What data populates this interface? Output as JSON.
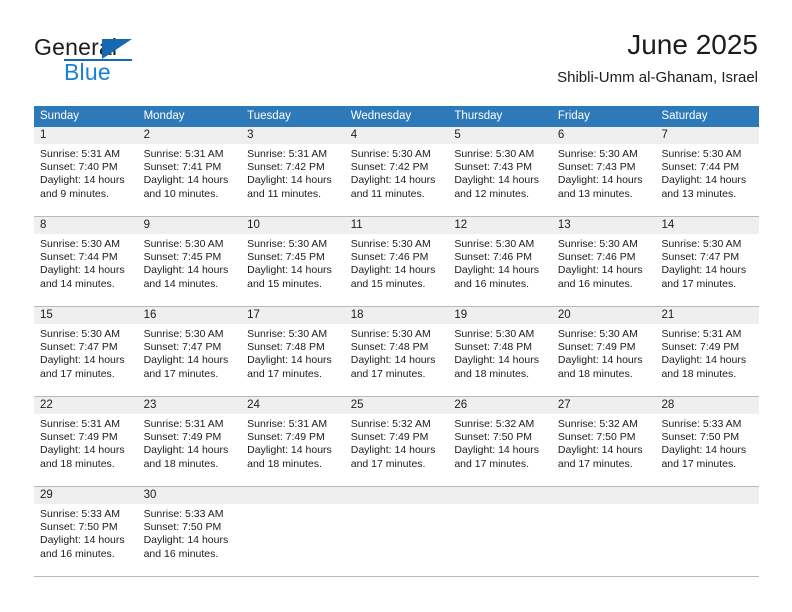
{
  "brand": {
    "name_primary": "General",
    "name_secondary": "Blue"
  },
  "header": {
    "title": "June 2025",
    "subtitle": "Shibli-Umm al-Ghanam, Israel"
  },
  "calendar": {
    "weekday_headers": [
      "Sunday",
      "Monday",
      "Tuesday",
      "Wednesday",
      "Thursday",
      "Friday",
      "Saturday"
    ],
    "header_bg": "#2e79b9",
    "daynum_bg": "#efefef",
    "weeks": [
      [
        {
          "day": "1",
          "sunrise": "Sunrise: 5:31 AM",
          "sunset": "Sunset: 7:40 PM",
          "daylight": "Daylight: 14 hours and 9 minutes."
        },
        {
          "day": "2",
          "sunrise": "Sunrise: 5:31 AM",
          "sunset": "Sunset: 7:41 PM",
          "daylight": "Daylight: 14 hours and 10 minutes."
        },
        {
          "day": "3",
          "sunrise": "Sunrise: 5:31 AM",
          "sunset": "Sunset: 7:42 PM",
          "daylight": "Daylight: 14 hours and 11 minutes."
        },
        {
          "day": "4",
          "sunrise": "Sunrise: 5:30 AM",
          "sunset": "Sunset: 7:42 PM",
          "daylight": "Daylight: 14 hours and 11 minutes."
        },
        {
          "day": "5",
          "sunrise": "Sunrise: 5:30 AM",
          "sunset": "Sunset: 7:43 PM",
          "daylight": "Daylight: 14 hours and 12 minutes."
        },
        {
          "day": "6",
          "sunrise": "Sunrise: 5:30 AM",
          "sunset": "Sunset: 7:43 PM",
          "daylight": "Daylight: 14 hours and 13 minutes."
        },
        {
          "day": "7",
          "sunrise": "Sunrise: 5:30 AM",
          "sunset": "Sunset: 7:44 PM",
          "daylight": "Daylight: 14 hours and 13 minutes."
        }
      ],
      [
        {
          "day": "8",
          "sunrise": "Sunrise: 5:30 AM",
          "sunset": "Sunset: 7:44 PM",
          "daylight": "Daylight: 14 hours and 14 minutes."
        },
        {
          "day": "9",
          "sunrise": "Sunrise: 5:30 AM",
          "sunset": "Sunset: 7:45 PM",
          "daylight": "Daylight: 14 hours and 14 minutes."
        },
        {
          "day": "10",
          "sunrise": "Sunrise: 5:30 AM",
          "sunset": "Sunset: 7:45 PM",
          "daylight": "Daylight: 14 hours and 15 minutes."
        },
        {
          "day": "11",
          "sunrise": "Sunrise: 5:30 AM",
          "sunset": "Sunset: 7:46 PM",
          "daylight": "Daylight: 14 hours and 15 minutes."
        },
        {
          "day": "12",
          "sunrise": "Sunrise: 5:30 AM",
          "sunset": "Sunset: 7:46 PM",
          "daylight": "Daylight: 14 hours and 16 minutes."
        },
        {
          "day": "13",
          "sunrise": "Sunrise: 5:30 AM",
          "sunset": "Sunset: 7:46 PM",
          "daylight": "Daylight: 14 hours and 16 minutes."
        },
        {
          "day": "14",
          "sunrise": "Sunrise: 5:30 AM",
          "sunset": "Sunset: 7:47 PM",
          "daylight": "Daylight: 14 hours and 17 minutes."
        }
      ],
      [
        {
          "day": "15",
          "sunrise": "Sunrise: 5:30 AM",
          "sunset": "Sunset: 7:47 PM",
          "daylight": "Daylight: 14 hours and 17 minutes."
        },
        {
          "day": "16",
          "sunrise": "Sunrise: 5:30 AM",
          "sunset": "Sunset: 7:47 PM",
          "daylight": "Daylight: 14 hours and 17 minutes."
        },
        {
          "day": "17",
          "sunrise": "Sunrise: 5:30 AM",
          "sunset": "Sunset: 7:48 PM",
          "daylight": "Daylight: 14 hours and 17 minutes."
        },
        {
          "day": "18",
          "sunrise": "Sunrise: 5:30 AM",
          "sunset": "Sunset: 7:48 PM",
          "daylight": "Daylight: 14 hours and 17 minutes."
        },
        {
          "day": "19",
          "sunrise": "Sunrise: 5:30 AM",
          "sunset": "Sunset: 7:48 PM",
          "daylight": "Daylight: 14 hours and 18 minutes."
        },
        {
          "day": "20",
          "sunrise": "Sunrise: 5:30 AM",
          "sunset": "Sunset: 7:49 PM",
          "daylight": "Daylight: 14 hours and 18 minutes."
        },
        {
          "day": "21",
          "sunrise": "Sunrise: 5:31 AM",
          "sunset": "Sunset: 7:49 PM",
          "daylight": "Daylight: 14 hours and 18 minutes."
        }
      ],
      [
        {
          "day": "22",
          "sunrise": "Sunrise: 5:31 AM",
          "sunset": "Sunset: 7:49 PM",
          "daylight": "Daylight: 14 hours and 18 minutes."
        },
        {
          "day": "23",
          "sunrise": "Sunrise: 5:31 AM",
          "sunset": "Sunset: 7:49 PM",
          "daylight": "Daylight: 14 hours and 18 minutes."
        },
        {
          "day": "24",
          "sunrise": "Sunrise: 5:31 AM",
          "sunset": "Sunset: 7:49 PM",
          "daylight": "Daylight: 14 hours and 18 minutes."
        },
        {
          "day": "25",
          "sunrise": "Sunrise: 5:32 AM",
          "sunset": "Sunset: 7:49 PM",
          "daylight": "Daylight: 14 hours and 17 minutes."
        },
        {
          "day": "26",
          "sunrise": "Sunrise: 5:32 AM",
          "sunset": "Sunset: 7:50 PM",
          "daylight": "Daylight: 14 hours and 17 minutes."
        },
        {
          "day": "27",
          "sunrise": "Sunrise: 5:32 AM",
          "sunset": "Sunset: 7:50 PM",
          "daylight": "Daylight: 14 hours and 17 minutes."
        },
        {
          "day": "28",
          "sunrise": "Sunrise: 5:33 AM",
          "sunset": "Sunset: 7:50 PM",
          "daylight": "Daylight: 14 hours and 17 minutes."
        }
      ],
      [
        {
          "day": "29",
          "sunrise": "Sunrise: 5:33 AM",
          "sunset": "Sunset: 7:50 PM",
          "daylight": "Daylight: 14 hours and 16 minutes."
        },
        {
          "day": "30",
          "sunrise": "Sunrise: 5:33 AM",
          "sunset": "Sunset: 7:50 PM",
          "daylight": "Daylight: 14 hours and 16 minutes."
        },
        {
          "day": "",
          "sunrise": "",
          "sunset": "",
          "daylight": ""
        },
        {
          "day": "",
          "sunrise": "",
          "sunset": "",
          "daylight": ""
        },
        {
          "day": "",
          "sunrise": "",
          "sunset": "",
          "daylight": ""
        },
        {
          "day": "",
          "sunrise": "",
          "sunset": "",
          "daylight": ""
        },
        {
          "day": "",
          "sunrise": "",
          "sunset": "",
          "daylight": ""
        }
      ]
    ]
  }
}
